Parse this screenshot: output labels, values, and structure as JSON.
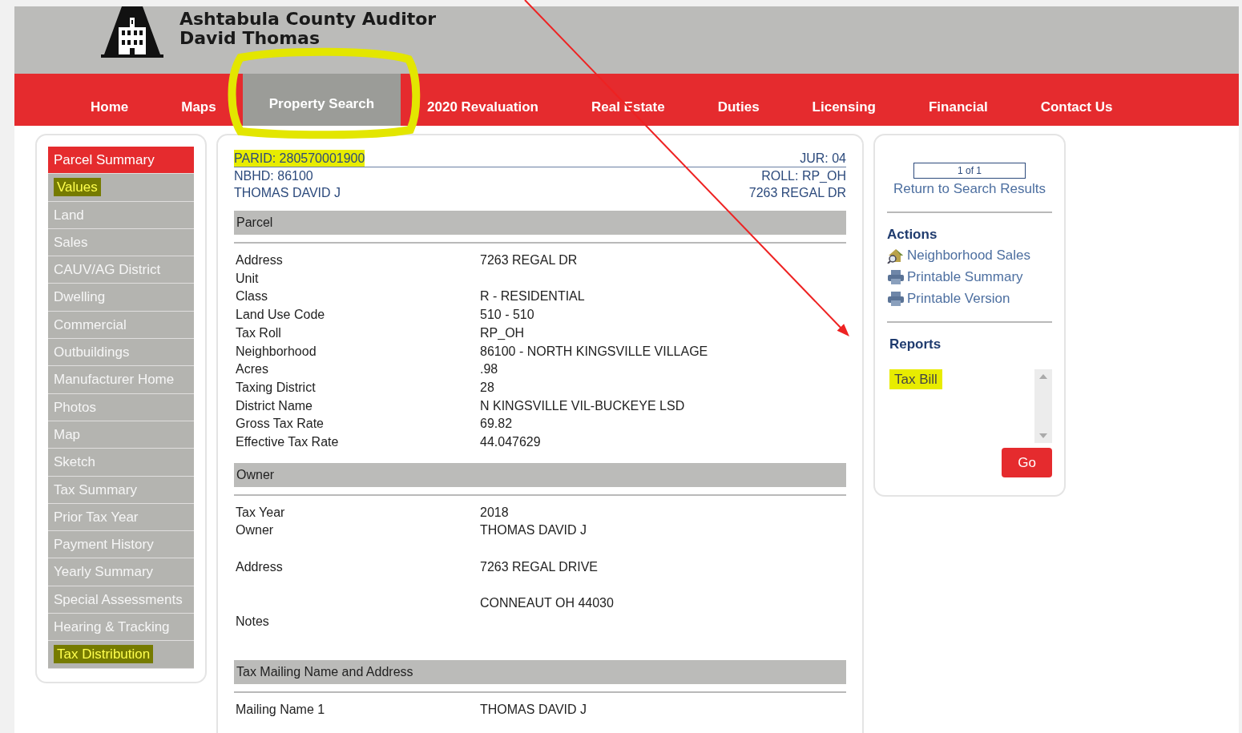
{
  "header": {
    "title": "Ashtabula County Auditor",
    "subtitle": "David Thomas"
  },
  "nav": [
    {
      "label": "Home",
      "selected": false
    },
    {
      "label": "Maps",
      "selected": false
    },
    {
      "label": "Property Search",
      "selected": true
    },
    {
      "label": "2020 Revaluation",
      "selected": false
    },
    {
      "label": "Real Estate",
      "selected": false
    },
    {
      "label": "Duties",
      "selected": false
    },
    {
      "label": "Licensing",
      "selected": false
    },
    {
      "label": "Financial",
      "selected": false
    },
    {
      "label": "Contact Us",
      "selected": false
    }
  ],
  "sidebar": {
    "items": [
      {
        "label": "Parcel Summary",
        "selected": true,
        "highlighted": false
      },
      {
        "label": "Values",
        "selected": false,
        "highlighted": true
      },
      {
        "label": "Land",
        "selected": false,
        "highlighted": false
      },
      {
        "label": "Sales",
        "selected": false,
        "highlighted": false
      },
      {
        "label": "CAUV/AG District",
        "selected": false,
        "highlighted": false
      },
      {
        "label": "Dwelling",
        "selected": false,
        "highlighted": false
      },
      {
        "label": "Commercial",
        "selected": false,
        "highlighted": false
      },
      {
        "label": "Outbuildings",
        "selected": false,
        "highlighted": false
      },
      {
        "label": "Manufacturer Home",
        "selected": false,
        "highlighted": false
      },
      {
        "label": "Photos",
        "selected": false,
        "highlighted": false
      },
      {
        "label": "Map",
        "selected": false,
        "highlighted": false
      },
      {
        "label": "Sketch",
        "selected": false,
        "highlighted": false
      },
      {
        "label": "Tax Summary",
        "selected": false,
        "highlighted": false
      },
      {
        "label": "Prior Tax Year",
        "selected": false,
        "highlighted": false
      },
      {
        "label": "Payment History",
        "selected": false,
        "highlighted": false
      },
      {
        "label": "Yearly Summary",
        "selected": false,
        "highlighted": false
      },
      {
        "label": "Special Assessments",
        "selected": false,
        "highlighted": false
      },
      {
        "label": "Hearing & Tracking",
        "selected": false,
        "highlighted": false
      },
      {
        "label": "Tax Distribution",
        "selected": false,
        "highlighted": true
      }
    ]
  },
  "parcel_header": [
    {
      "left": "PARID: 280570001900",
      "right": "JUR: 04",
      "highlighted": true
    },
    {
      "left": "NBHD: 86100",
      "right": "ROLL: RP_OH",
      "highlighted": false
    },
    {
      "left": "THOMAS DAVID J",
      "right": "7263 REGAL DR",
      "highlighted": false
    }
  ],
  "sections": [
    {
      "title": "Parcel",
      "rows": [
        {
          "kind": "field",
          "label": "Address",
          "value": "7263 REGAL DR"
        },
        {
          "kind": "field",
          "label": "Unit"
        },
        {
          "kind": "field",
          "label": "Class",
          "value": "R - RESIDENTIAL"
        },
        {
          "kind": "field",
          "label": "Land Use Code",
          "value": "510 - 510"
        },
        {
          "kind": "field",
          "label": "Tax Roll",
          "value": "RP_OH"
        },
        {
          "kind": "field",
          "label": "Neighborhood",
          "value": "86100 - NORTH KINGSVILLE VILLAGE"
        },
        {
          "kind": "field",
          "label": "Acres",
          "value": ".98"
        },
        {
          "kind": "field",
          "label": "Taxing District",
          "value": "28"
        },
        {
          "kind": "field",
          "label": "District Name",
          "value": "N KINGSVILLE VIL-BUCKEYE LSD"
        },
        {
          "kind": "field",
          "label": "Gross Tax Rate",
          "value": "69.82"
        },
        {
          "kind": "field",
          "label": "Effective Tax Rate",
          "value": "44.047629"
        }
      ]
    },
    {
      "title": "Owner",
      "rows": [
        {
          "kind": "field",
          "label": "Tax Year",
          "value": "2018"
        },
        {
          "kind": "field",
          "label": "Owner",
          "value": "THOMAS DAVID J"
        },
        {
          "kind": "spacer"
        },
        {
          "kind": "field",
          "label": "Address",
          "value": "7263 REGAL DRIVE"
        },
        {
          "kind": "spacer"
        },
        {
          "kind": "field",
          "value": "CONNEAUT OH 44030"
        },
        {
          "kind": "field",
          "label": "Notes"
        },
        {
          "kind": "spacer"
        }
      ]
    },
    {
      "title": "Tax Mailing Name and Address",
      "rows": [
        {
          "kind": "field",
          "label": "Mailing Name 1",
          "value": "THOMAS DAVID J"
        }
      ]
    }
  ],
  "right_panel": {
    "pager": "1 of 1",
    "return_link": "Return to Search Results",
    "actions": {
      "title": "Actions",
      "items": [
        {
          "label": "Neighborhood Sales",
          "kind": "house"
        },
        {
          "label": "Printable Summary",
          "kind": "printer"
        },
        {
          "label": "Printable Version",
          "kind": "printer"
        }
      ]
    },
    "reports": {
      "title": "Reports",
      "options": [
        {
          "label": "Tax Bill",
          "highlighted": true
        }
      ],
      "button": "Go"
    }
  },
  "annotations": {
    "circle": true,
    "arrow": true
  }
}
